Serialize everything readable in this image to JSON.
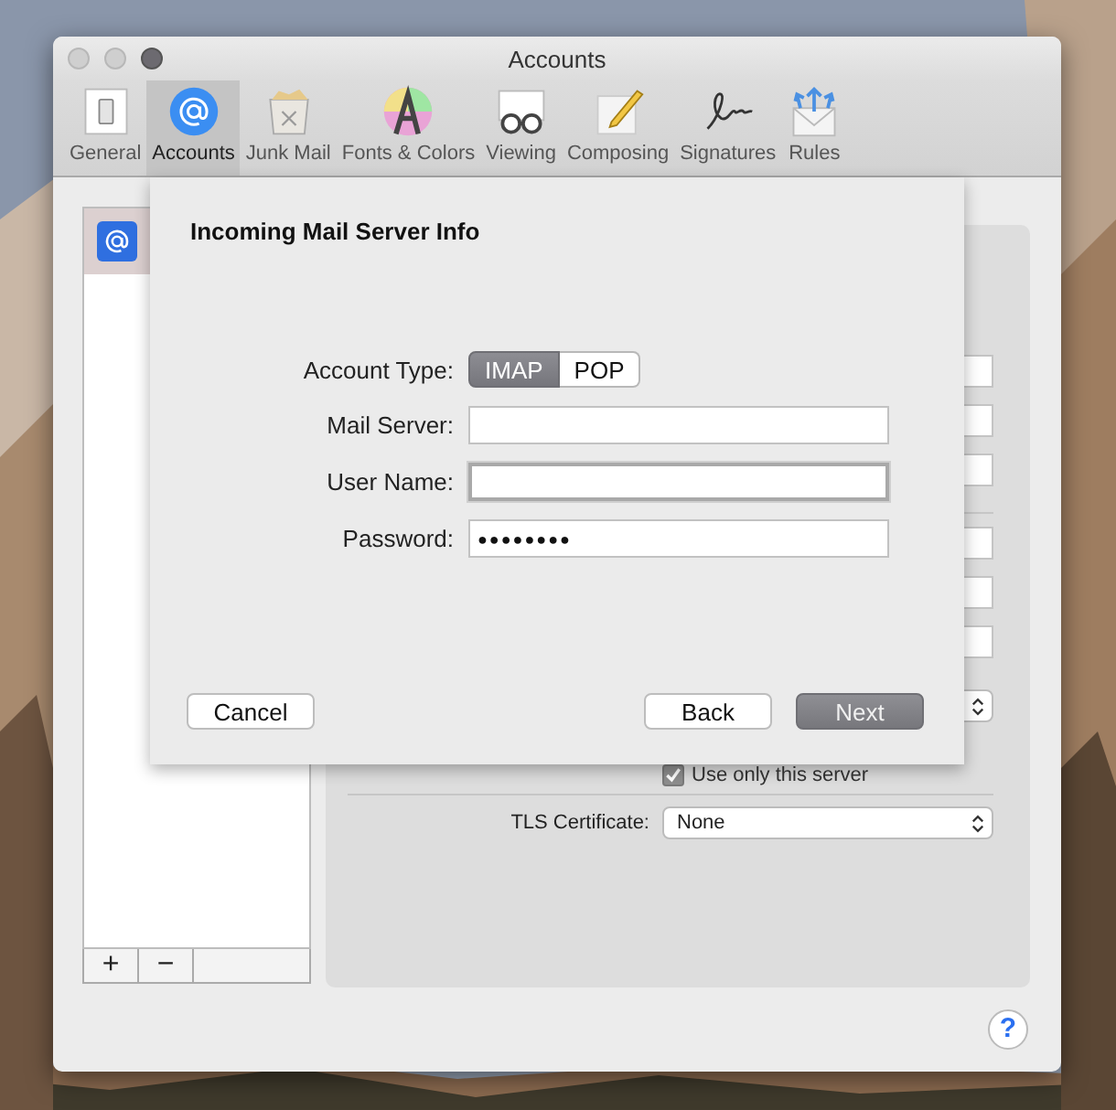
{
  "window": {
    "title": "Accounts"
  },
  "toolbar": [
    {
      "label": "General",
      "selected": false
    },
    {
      "label": "Accounts",
      "selected": true
    },
    {
      "label": "Junk Mail",
      "selected": false
    },
    {
      "label": "Fonts & Colors",
      "selected": false
    },
    {
      "label": "Viewing",
      "selected": false
    },
    {
      "label": "Composing",
      "selected": false
    },
    {
      "label": "Signatures",
      "selected": false
    },
    {
      "label": "Rules",
      "selected": false
    }
  ],
  "account_list": {
    "items": [
      {
        "selected": true
      }
    ],
    "buttons": [
      "+",
      "−"
    ]
  },
  "settings_panel": {
    "use_only_this_server": {
      "label": "Use only this server",
      "checked": true
    },
    "tls_certificate": {
      "label": "TLS Certificate:",
      "value": "None"
    }
  },
  "sheet": {
    "title": "Incoming Mail Server Info",
    "account_type": {
      "label": "Account Type:",
      "options": [
        {
          "label": "IMAP",
          "selected": true
        },
        {
          "label": "POP",
          "selected": false
        }
      ]
    },
    "fields": [
      {
        "label": "Mail Server:",
        "kind": "text",
        "focused": false
      },
      {
        "label": "User Name:",
        "kind": "text",
        "focused": true
      },
      {
        "label": "Password:",
        "kind": "password",
        "value": "●●●●●●●●",
        "focused": false
      }
    ],
    "buttons": [
      {
        "label": "Cancel",
        "kind": "normal"
      },
      {
        "label": "Back",
        "kind": "normal"
      },
      {
        "label": "Next",
        "kind": "default"
      }
    ]
  },
  "help_button": "?"
}
